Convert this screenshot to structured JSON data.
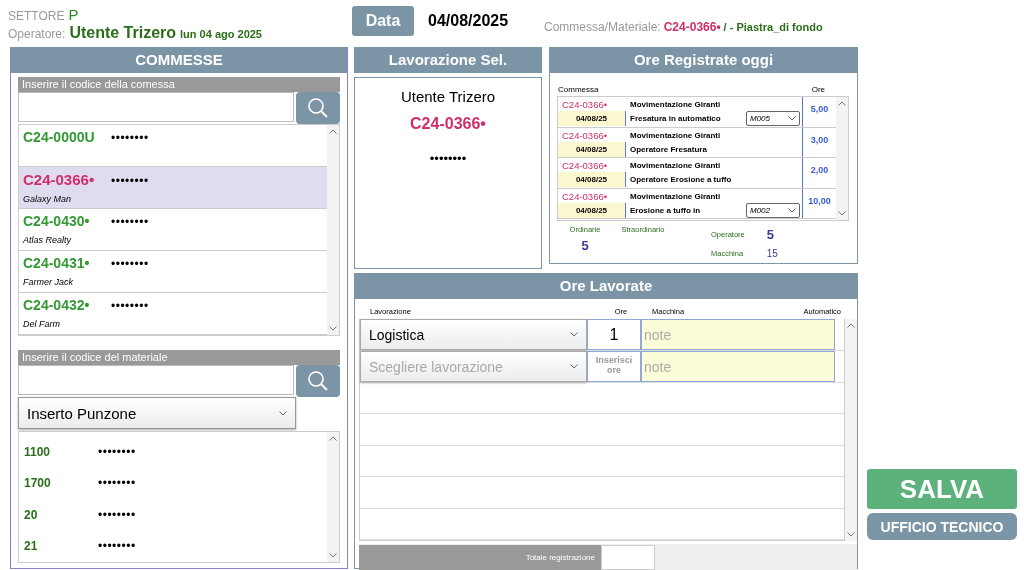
{
  "header": {
    "sector_label": "SETTORE",
    "sector": "P",
    "operator_label": "Operatore:",
    "operator": "Utente Trizero",
    "day": "lun 04 ago 2025",
    "date_button": "Data",
    "date": "04/08/2025",
    "selection_label": "Commessa/Materiale:",
    "selection_code": "C24-0366•",
    "selection_rest": "/ - Piastra_di fondo"
  },
  "commesse": {
    "title": "COMMESSE",
    "search_label": "Inserire il codice della comessa",
    "items": [
      {
        "code": "C24-0000U",
        "mask": "••••••••",
        "selected": false
      },
      {
        "code": "C24-0366•",
        "mask": "••••••••",
        "client": "Galaxy Man",
        "selected": true
      },
      {
        "code": "C24-0430•",
        "mask": "••••••••",
        "client": "Atlas Realty",
        "selected": false
      },
      {
        "code": "C24-0431•",
        "mask": "••••••••",
        "client": "Farmer Jack",
        "selected": false
      },
      {
        "code": "C24-0432•",
        "mask": "••••••••",
        "client": "Del Farm",
        "selected": false
      }
    ],
    "material_label": "Inserire il codice del materiale",
    "material_select": "Inserto Punzone",
    "materials": [
      {
        "code": "1100",
        "mask": "••••••••"
      },
      {
        "code": "1700",
        "mask": "••••••••"
      },
      {
        "code": "20",
        "mask": "••••••••"
      },
      {
        "code": "21",
        "mask": "••••••••"
      }
    ]
  },
  "lavorazione_sel": {
    "title": "Lavorazione Sel.",
    "user": "Utente Trizero",
    "code": "C24-0366•",
    "mask": "••••••••"
  },
  "ore_registrate": {
    "title": "Ore Registrate oggi",
    "columns": [
      "Commessa",
      "Ore"
    ],
    "rows": [
      {
        "code": "C24-0366•",
        "date": "04/08/25",
        "activity": "Movimentazione Giranti",
        "task": "Fresatura in automatico",
        "machine": "M005",
        "hours": "5,00"
      },
      {
        "code": "C24-0366•",
        "date": "04/08/25",
        "activity": "Movimentazione Giranti",
        "task": "Operatore Fresatura",
        "hours": "3,00"
      },
      {
        "code": "C24-0366•",
        "date": "04/08/25",
        "activity": "Movimentazione Giranti",
        "task": "Operatore Erosione a tuffo",
        "hours": "2,00"
      },
      {
        "code": "C24-0366•",
        "date": "04/08/25",
        "activity": "Movimentazione Giranti",
        "task": "Erosione a tuffo in",
        "machine": "M002",
        "hours": "10,00"
      }
    ],
    "ordinarie_label": "Ordinarie",
    "ordinarie": "5",
    "straordinario_label": "Straordinario",
    "operatore_label": "Operatore",
    "operatore": "5",
    "macchina_label": "Macchina",
    "macchina": "15"
  },
  "ore_lavorate": {
    "title": "Ore Lavorate",
    "columns": [
      "Lavorazione",
      "Ore",
      "Macchina",
      "Automatico"
    ],
    "rows": [
      {
        "kind": "filled",
        "lavorazione": "Logistica",
        "ore": "1",
        "note_placeholder": "note"
      },
      {
        "kind": "empty",
        "lavorazione_placeholder": "Scegliere lavorazione",
        "ore_placeholder": "Inserisci ore",
        "note_placeholder": "note"
      }
    ],
    "total_label": "Totale registrazione"
  },
  "buttons": {
    "save": "SALVA",
    "office": "UFFICIO TECNICO"
  }
}
